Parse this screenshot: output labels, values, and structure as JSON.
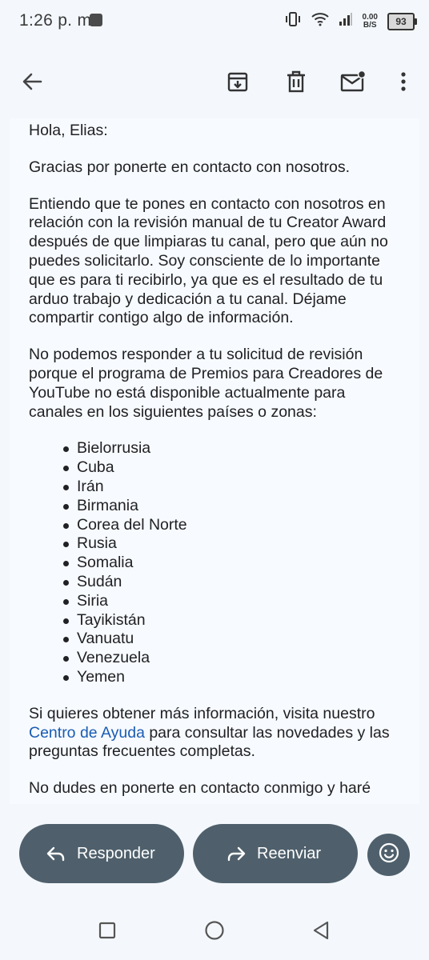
{
  "status_bar": {
    "time": "1:26 p. m.",
    "net_speed_value": "0.00",
    "net_speed_unit": "B/S",
    "battery": "93"
  },
  "toolbar": {
    "back_icon": "arrow-back-icon",
    "archive_icon": "archive-icon",
    "delete_icon": "trash-icon",
    "mark_unread_icon": "mail-unread-icon",
    "more_icon": "more-vert-icon"
  },
  "email": {
    "greeting": "Hola, Elias:",
    "p1": "Gracias por ponerte en contacto con nosotros.",
    "p2": "Entiendo que te pones en contacto con nosotros en relación con la revisión manual de tu Creator Award después de que limpiaras tu canal, pero que aún no puedes solicitarlo. Soy consciente de lo importante que es para ti recibirlo, ya que es el resultado de tu arduo trabajo y dedicación a tu canal. Déjame compartir contigo algo de información.",
    "p3": "No podemos responder a tu solicitud de revisión porque el programa de Premios para Creadores de YouTube no está disponible actualmente para canales en los siguientes países o zonas:",
    "countries": [
      "Bielorrusia",
      "Cuba",
      "Irán",
      "Birmania",
      "Corea del Norte",
      "Rusia",
      "Somalia",
      "Sudán",
      "Siria",
      "Tayikistán",
      "Vanuatu",
      "Venezuela",
      "Yemen"
    ],
    "p4_before": "Si quieres obtener más información, visita nuestro ",
    "p4_link": "Centro de Ayuda",
    "p4_after": " para consultar las novedades y las preguntas frecuentes completas.",
    "p5": "No dudes en ponerte en contacto conmigo y haré"
  },
  "actions": {
    "reply_label": "Responder",
    "forward_label": "Reenviar",
    "emoji_icon": "smiley-icon"
  },
  "colors": {
    "accent_button": "#4f606c",
    "link": "#1a5cb4",
    "card_background": "#f7fafe"
  }
}
